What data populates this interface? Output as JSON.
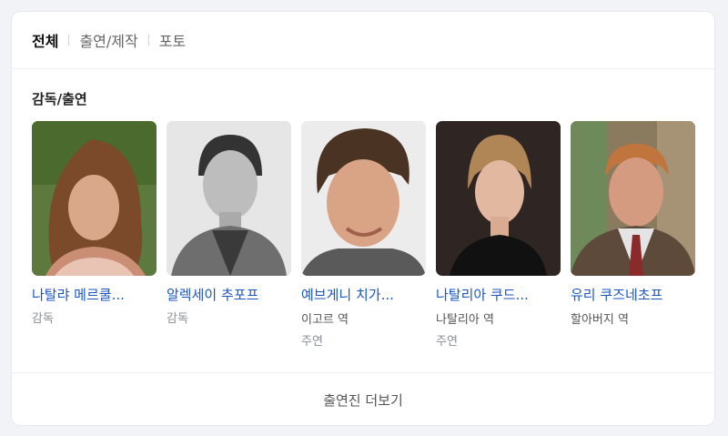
{
  "tabs": [
    {
      "label": "전체"
    },
    {
      "label": "출연/제작"
    },
    {
      "label": "포토"
    }
  ],
  "section": {
    "title": "감독/출연"
  },
  "cast": [
    {
      "name": "나탈랴 메르쿨...",
      "role": "",
      "credit": "감독"
    },
    {
      "name": "알렉세이 추포프",
      "role": "",
      "credit": "감독"
    },
    {
      "name": "예브게니 치가...",
      "role": "이고르 역",
      "credit": "주연"
    },
    {
      "name": "나탈리아 쿠드...",
      "role": "나탈리아 역",
      "credit": "주연"
    },
    {
      "name": "유리 쿠즈네초프",
      "role": "할아버지 역",
      "credit": ""
    }
  ],
  "more": {
    "label": "출연진 더보기"
  },
  "colors": {
    "link": "#1a55c4",
    "accent_text": "#111111"
  }
}
